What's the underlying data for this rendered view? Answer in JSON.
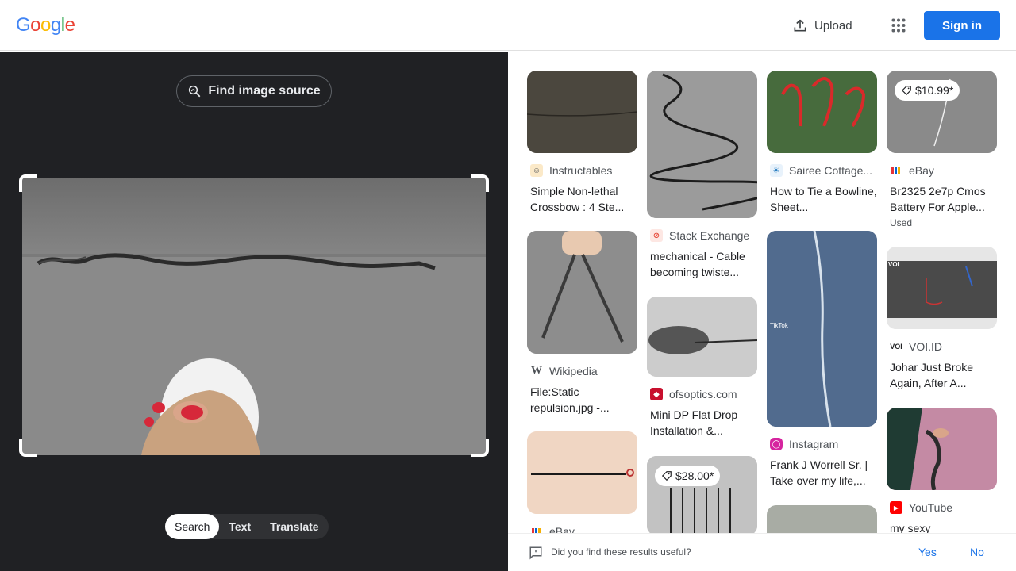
{
  "header": {
    "logo": [
      "G",
      "o",
      "o",
      "g",
      "l",
      "e"
    ],
    "upload_label": "Upload",
    "signin_label": "Sign in"
  },
  "left_panel": {
    "find_source_label": "Find image source",
    "tabs": [
      {
        "label": "Search",
        "active": true
      },
      {
        "label": "Text",
        "active": false
      },
      {
        "label": "Translate",
        "active": false
      }
    ]
  },
  "results": [
    {
      "source": "Instructables",
      "title": "Simple Non-lethal Crossbow : 4 Ste...",
      "icon": "instructables-icon"
    },
    {
      "source": "Stack Exchange",
      "title": "mechanical - Cable becoming twiste...",
      "icon": "stack-exchange-icon"
    },
    {
      "source": "Sairee Cottage...",
      "title": "How to Tie a Bowline, Sheet...",
      "icon": "sairee-cottage-icon"
    },
    {
      "source": "eBay",
      "title": "Br2325 2e7p Cmos Battery For Apple...",
      "price": "$10.99*",
      "extra": "Used",
      "icon": "ebay-icon"
    },
    {
      "source": "Wikipedia",
      "title": "File:Static repulsion.jpg -...",
      "icon": "wikipedia-icon"
    },
    {
      "source": "ofsoptics.com",
      "title": "Mini DP Flat Drop Installation &...",
      "icon": "ofsoptics-icon"
    },
    {
      "source": "Instagram",
      "title": "Frank J Worrell Sr. | Take over my life,...",
      "icon": "instagram-icon"
    },
    {
      "source": "VOI.ID",
      "title": "Johar Just Broke Again, After A...",
      "icon": "voi-icon"
    },
    {
      "source": "eBay",
      "title": "",
      "icon": "ebay-icon"
    },
    {
      "source": "",
      "title": "",
      "price": "$28.00*",
      "icon": ""
    },
    {
      "source": "YouTube",
      "title": "my sexy",
      "icon": "youtube-icon"
    }
  ],
  "feedback": {
    "question": "Did you find these results useful?",
    "yes": "Yes",
    "no": "No"
  },
  "colors": {
    "google_blue": "#4285f4",
    "google_red": "#ea4335",
    "google_yellow": "#fbbc05",
    "google_green": "#34a853",
    "accent": "#1a73e8",
    "dark_panel": "#202124"
  }
}
